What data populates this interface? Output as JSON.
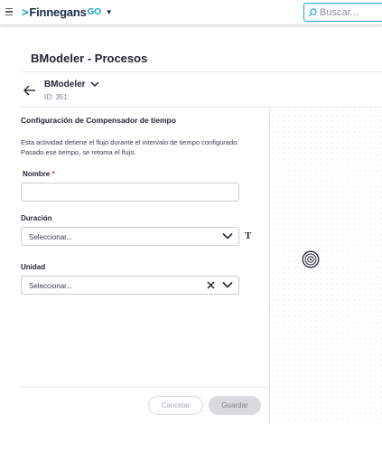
{
  "header": {
    "logo_main": "Finnegans",
    "logo_suffix": "GO",
    "search_placeholder": "Buscar..."
  },
  "page": {
    "title": "BModeler - Procesos"
  },
  "process": {
    "name": "BModeler",
    "id_label": "ID: 351"
  },
  "form": {
    "section_title": "Configuración de Compensador de tiempo",
    "description": "Esta actividad detiene el flujo durante el intervalo de tiempo configurado. Pasado ese tiempo, se retoma el flujo.",
    "nombre": {
      "label": "Nombre",
      "required_mark": "*",
      "value": ""
    },
    "duracion": {
      "label": "Duración",
      "value": "Seleccionar..."
    },
    "unidad": {
      "label": "Unidad",
      "value": "Seleccionar..."
    }
  },
  "footer": {
    "cancel_label": "Cancelar",
    "save_label": "Guardar"
  },
  "icons": {
    "menu": "hamburger-icon",
    "search": "search-icon",
    "back": "arrow-left-icon",
    "dropdown": "chevron-down-icon",
    "clear": "close-icon",
    "text_type": "text-type-icon",
    "timer_event": "timer-event-icon"
  },
  "colors": {
    "accent": "#1aa3c9",
    "brand_dark": "#1a2b49",
    "required": "#d93a3a"
  }
}
